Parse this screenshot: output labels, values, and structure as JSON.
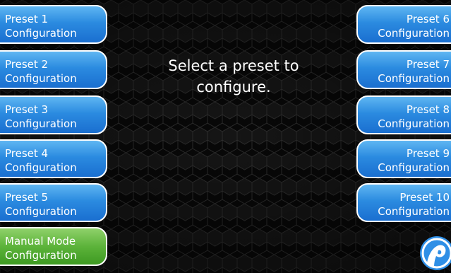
{
  "left_buttons": [
    {
      "line1": "Preset 1",
      "line2": "Configuration"
    },
    {
      "line1": "Preset 2",
      "line2": "Configuration"
    },
    {
      "line1": "Preset 3",
      "line2": "Configuration"
    },
    {
      "line1": "Preset 4",
      "line2": "Configuration"
    },
    {
      "line1": "Preset 5",
      "line2": "Configuration"
    },
    {
      "line1": "Manual Mode",
      "line2": "Configuration"
    }
  ],
  "right_buttons": [
    {
      "line1": "Preset 6",
      "line2": "Configuration"
    },
    {
      "line1": "Preset 7",
      "line2": "Configuration"
    },
    {
      "line1": "Preset 8",
      "line2": "Configuration"
    },
    {
      "line1": "Preset 9",
      "line2": "Configuration"
    },
    {
      "line1": "Preset 10",
      "line2": "Configuration"
    }
  ],
  "prompt": {
    "line1": "Select a preset to",
    "line2": "configure."
  },
  "colors": {
    "preset_button": "#2b8be0",
    "manual_button": "#5cb33a",
    "background": "#0b0b0b",
    "logo": "#2f8fe6"
  },
  "icons": {
    "logo": "brand-logo-icon"
  }
}
